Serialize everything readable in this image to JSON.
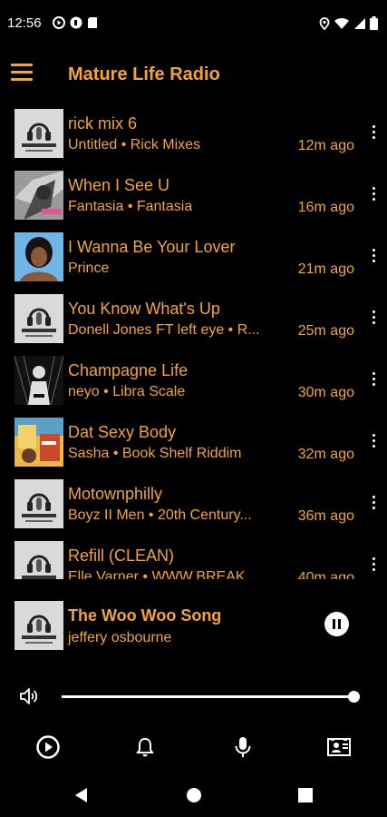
{
  "status_bar": {
    "time": "12:56"
  },
  "app": {
    "title": "Mature Life Radio"
  },
  "colors": {
    "accent": "#f3a43a",
    "background": "#000000",
    "icon": "#ffffff"
  },
  "songs": [
    {
      "title": "rick mix 6",
      "subtitle": "Untitled • Rick Mixes",
      "time": "12m ago",
      "art": "mature-life-logo"
    },
    {
      "title": "When I See U",
      "subtitle": "Fantasia • Fantasia",
      "time": "16m ago",
      "art": "fantasia-cover"
    },
    {
      "title": "I Wanna Be Your Lover",
      "subtitle": "Prince",
      "time": "21m ago",
      "art": "prince-cover"
    },
    {
      "title": "You Know What's Up",
      "subtitle": "Donell Jones FT left eye • R...",
      "time": "25m ago",
      "art": "mature-life-logo"
    },
    {
      "title": "Champagne Life",
      "subtitle": "neyo • Libra Scale",
      "time": "30m ago",
      "art": "neyo-cover"
    },
    {
      "title": "Dat Sexy Body",
      "subtitle": "Sasha • Book Shelf Riddim",
      "time": "32m ago",
      "art": "book-shelf-riddim-cover"
    },
    {
      "title": "Motownphilly",
      "subtitle": "Boyz II Men • 20th Century...",
      "time": "36m ago",
      "art": "mature-life-logo"
    },
    {
      "title": "Refill (CLEAN)",
      "subtitle": "Elle Varner • WWW.BREAKZ...",
      "time": "40m ago",
      "art": "mature-life-logo"
    }
  ],
  "now_playing": {
    "title": "The Woo Woo Song",
    "artist": "jeffery osbourne",
    "art": "mature-life-logo",
    "state": "playing"
  },
  "volume": {
    "level": 1.0
  },
  "bottom_nav": [
    "play-circle-icon",
    "bell-icon",
    "microphone-icon",
    "contact-card-icon"
  ]
}
